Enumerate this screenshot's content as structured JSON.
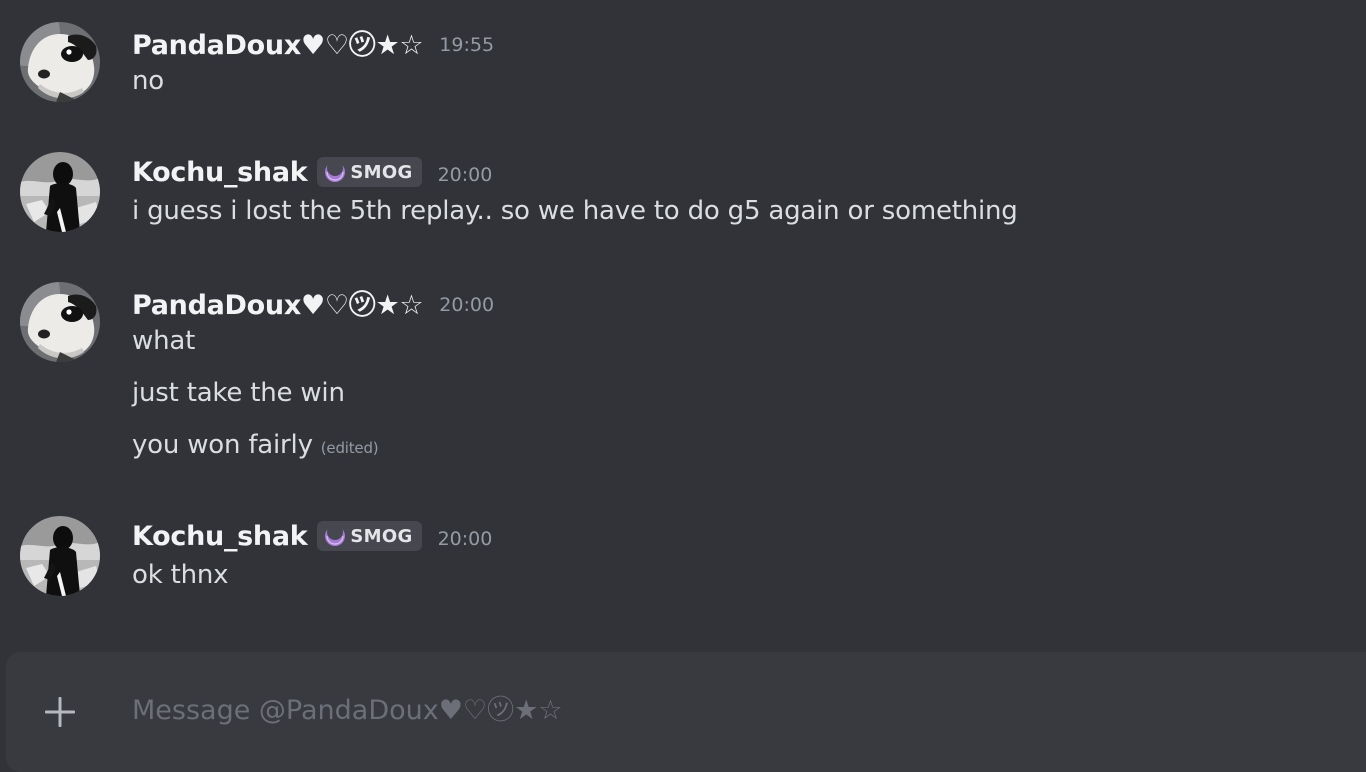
{
  "messages": [
    {
      "username": "PandaDoux♥♡㋡★☆",
      "timestamp": "19:55",
      "avatar": "dog-avatar",
      "lines": [
        "no"
      ]
    },
    {
      "username": "Kochu_shak",
      "tag": {
        "label": "SMOG",
        "icon": "purple-moon-icon"
      },
      "timestamp": "20:00",
      "avatar": "silhouette-avatar",
      "lines": [
        "i guess i lost the 5th replay.. so we have to do g5 again or something"
      ]
    },
    {
      "username": "PandaDoux♥♡㋡★☆",
      "timestamp": "20:00",
      "avatar": "dog-avatar",
      "lines": [
        "what",
        "just take the win",
        "you won fairly"
      ],
      "edited_label": "(edited)"
    },
    {
      "username": "Kochu_shak",
      "tag": {
        "label": "SMOG",
        "icon": "purple-moon-icon"
      },
      "timestamp": "20:00",
      "avatar": "silhouette-avatar",
      "lines": [
        "ok thnx"
      ]
    }
  ],
  "composer": {
    "placeholder": "Message @PandaDoux♥♡㋡★☆",
    "value": "",
    "add_icon": "plus-icon"
  },
  "colors": {
    "background": "#313338",
    "composer_background": "#383a40",
    "username": "#f2f3f5",
    "text": "#dbdee1",
    "timestamp": "#949ba4",
    "tag_background": "#46474f",
    "tag_icon": "#a77ad8"
  }
}
